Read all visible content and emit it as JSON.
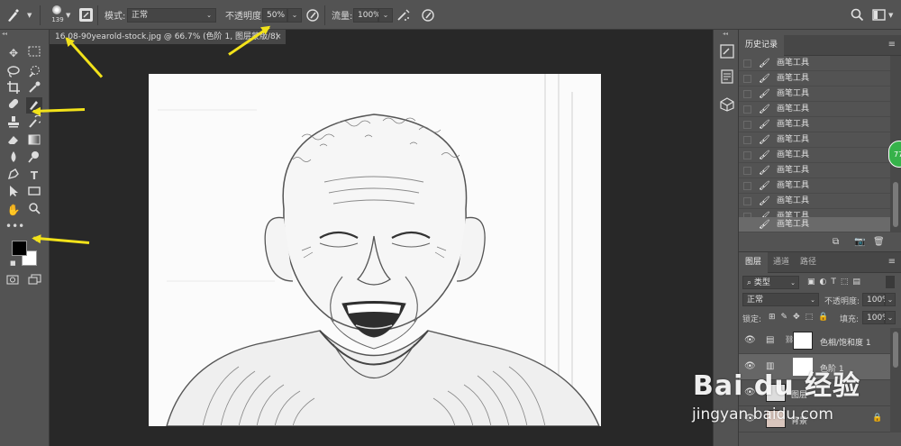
{
  "options_bar": {
    "brush_size": "139",
    "mode_label": "模式:",
    "mode_value": "正常",
    "opacity_label": "不透明度:",
    "opacity_value": "50%",
    "flow_label": "流量:",
    "flow_value": "100%"
  },
  "document": {
    "tab_title": "16",
    "tab_title_full": "16 08-90yearold-stock.jpg @ 66.7% (色阶 1, 图层蒙版/8)"
  },
  "history_panel": {
    "tab": "历史记录",
    "items": [
      "画笔工具",
      "画笔工具",
      "画笔工具",
      "画笔工具",
      "画笔工具",
      "画笔工具",
      "画笔工具",
      "画笔工具",
      "画笔工具",
      "画笔工具",
      "画笔工具",
      "画笔工具"
    ]
  },
  "layers_panel": {
    "tabs": [
      "图层",
      "通道",
      "路径"
    ],
    "filter_kind": "类型",
    "blend_mode": "正常",
    "opacity_label": "不透明度:",
    "opacity_value": "100%",
    "lock_label": "锁定:",
    "fill_label": "填充:",
    "fill_value": "100%",
    "layers": [
      {
        "name": "色相/饱和度 1"
      },
      {
        "name": "色阶 1"
      },
      {
        "name": "图层"
      },
      {
        "name": "背景"
      }
    ]
  },
  "badge": {
    "text": "77"
  },
  "watermark": {
    "logo": "Bai du 经验",
    "url": "jingyan.baidu.com"
  },
  "colors": {
    "arrow": "#f2e21a",
    "panel": "#535353",
    "workspace": "#282828",
    "badge": "#36b24a"
  }
}
